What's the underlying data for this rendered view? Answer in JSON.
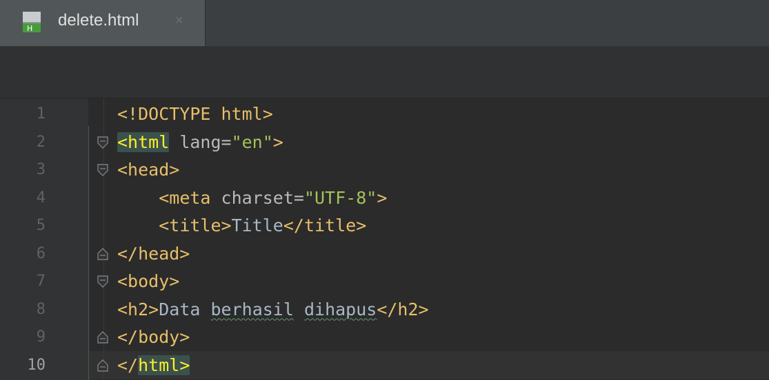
{
  "tab": {
    "icon": "html-file-icon",
    "label": "delete.html",
    "close_glyph": "×"
  },
  "editor": {
    "current_line": 10,
    "lines": [
      {
        "no": "1",
        "tokens": [
          {
            "t": "<!DOCTYPE html>",
            "c": "tag"
          }
        ]
      },
      {
        "no": "2",
        "tokens": [
          {
            "t": "<html",
            "c": "tag match"
          },
          {
            "t": " lang=",
            "c": "attr"
          },
          {
            "t": "\"en\"",
            "c": "str"
          },
          {
            "t": ">",
            "c": "tag"
          }
        ]
      },
      {
        "no": "3",
        "tokens": [
          {
            "t": "<head>",
            "c": "tag"
          }
        ]
      },
      {
        "no": "4",
        "tokens": [
          {
            "t": "    ",
            "c": "txt"
          },
          {
            "t": "<meta",
            "c": "tag"
          },
          {
            "t": " charset=",
            "c": "attr"
          },
          {
            "t": "\"UTF-8\"",
            "c": "str"
          },
          {
            "t": ">",
            "c": "tag"
          }
        ]
      },
      {
        "no": "5",
        "tokens": [
          {
            "t": "    ",
            "c": "txt"
          },
          {
            "t": "<title>",
            "c": "tag"
          },
          {
            "t": "Title",
            "c": "txt"
          },
          {
            "t": "</title>",
            "c": "tag"
          }
        ]
      },
      {
        "no": "6",
        "tokens": [
          {
            "t": "</head>",
            "c": "tag"
          }
        ]
      },
      {
        "no": "7",
        "tokens": [
          {
            "t": "<body>",
            "c": "tag"
          }
        ]
      },
      {
        "no": "8",
        "tokens": [
          {
            "t": "<h2>",
            "c": "tag"
          },
          {
            "t": "Data ",
            "c": "txt"
          },
          {
            "t": "berhasil",
            "c": "txt typo"
          },
          {
            "t": " ",
            "c": "txt"
          },
          {
            "t": "dihapus",
            "c": "txt typo"
          },
          {
            "t": "</h2>",
            "c": "tag"
          }
        ]
      },
      {
        "no": "9",
        "tokens": [
          {
            "t": "</body>",
            "c": "tag"
          }
        ]
      },
      {
        "no": "10",
        "tokens": [
          {
            "t": "</",
            "c": "tag"
          },
          {
            "t": "html",
            "c": "tag match"
          },
          {
            "t": ">",
            "c": "tag match"
          }
        ]
      }
    ],
    "folds": [
      {
        "line": 2,
        "kind": "open"
      },
      {
        "line": 3,
        "kind": "open"
      },
      {
        "line": 6,
        "kind": "close"
      },
      {
        "line": 7,
        "kind": "open"
      },
      {
        "line": 9,
        "kind": "close"
      },
      {
        "line": 10,
        "kind": "close"
      }
    ]
  },
  "colors": {
    "tag": "#e8bf6a",
    "string": "#a5c25c",
    "attribute": "#bababa",
    "text": "#a9b7c6",
    "bracket_match": "#ffef28",
    "background": "#2b2b2b"
  }
}
